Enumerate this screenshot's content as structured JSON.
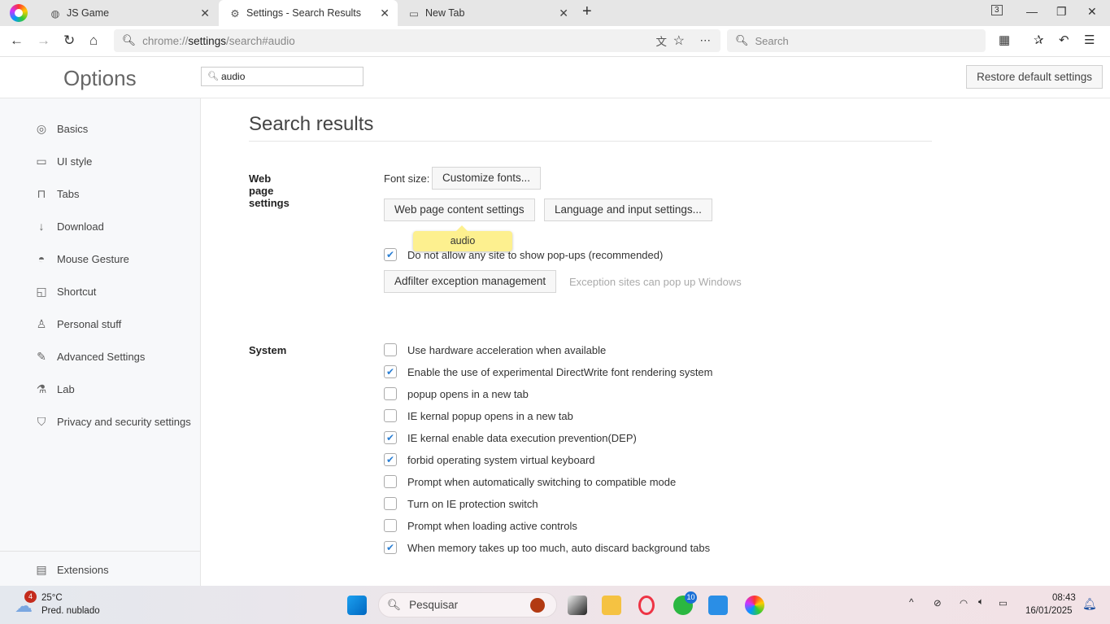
{
  "browser": {
    "tabs": [
      {
        "label": "JS Game",
        "icon": "globe-icon"
      },
      {
        "label": "Settings - Search Results",
        "icon": "gear-icon",
        "active": true
      },
      {
        "label": "New Tab",
        "icon": "newtab-icon"
      }
    ],
    "tab_count": "3",
    "address_prefix": "chrome://",
    "address_host": "settings",
    "address_path": "/search#audio",
    "search_placeholder": "Search"
  },
  "header": {
    "title": "Options",
    "filter_value": "audio",
    "restore_label": "Restore default settings"
  },
  "sidebar": {
    "items": [
      {
        "label": "Basics",
        "icon": "basics-icon"
      },
      {
        "label": "UI style",
        "icon": "window-icon"
      },
      {
        "label": "Tabs",
        "icon": "tab-icon"
      },
      {
        "label": "Download",
        "icon": "download-icon"
      },
      {
        "label": "Mouse Gesture",
        "icon": "mouse-icon"
      },
      {
        "label": "Shortcut",
        "icon": "shortcut-icon"
      },
      {
        "label": "Personal stuff",
        "icon": "person-icon"
      },
      {
        "label": "Advanced Settings",
        "icon": "wrench-icon"
      },
      {
        "label": "Lab",
        "icon": "flask-icon"
      },
      {
        "label": "Privacy and security settings",
        "icon": "shield-icon"
      }
    ],
    "footer": {
      "label": "Extensions",
      "icon": "extensions-icon"
    }
  },
  "main": {
    "title": "Search results",
    "web": {
      "heading": "Web page settings",
      "font_size_label": "Font size:",
      "customize_fonts": "Customize fonts...",
      "content_settings": "Web page content settings",
      "language_settings": "Language and input settings...",
      "tooltip": "audio",
      "popups_label": "Do not allow any site to show pop-ups (recommended)",
      "popups_checked": true,
      "adfilter": "Adfilter exception management",
      "adfilter_hint": "Exception sites can pop up Windows"
    },
    "system": {
      "heading": "System",
      "options": [
        {
          "label": "Use hardware acceleration when available",
          "checked": false
        },
        {
          "label": "Enable the use of experimental DirectWrite font rendering system",
          "checked": true
        },
        {
          "label": "popup opens in a new tab",
          "checked": false
        },
        {
          "label": "IE kernal popup opens in a new tab",
          "checked": false
        },
        {
          "label": "IE kernal enable data execution prevention(DEP)",
          "checked": true
        },
        {
          "label": "forbid operating system virtual keyboard",
          "checked": true
        },
        {
          "label": "Prompt when automatically switching to compatible mode",
          "checked": false
        },
        {
          "label": "Turn on IE protection switch",
          "checked": false
        },
        {
          "label": "Prompt when loading active controls",
          "checked": false
        },
        {
          "label": "When memory takes up too much, auto discard background tabs",
          "checked": true
        }
      ]
    }
  },
  "taskbar": {
    "weather_temp": "25°C",
    "weather_desc": "Pred. nublado",
    "weather_badge": "4",
    "search_label": "Pesquisar",
    "whatsapp_badge": "10",
    "time": "08:43",
    "date": "16/01/2025"
  },
  "colors": {
    "accent": "#2a7fd4",
    "tooltip": "#fdf08f"
  }
}
